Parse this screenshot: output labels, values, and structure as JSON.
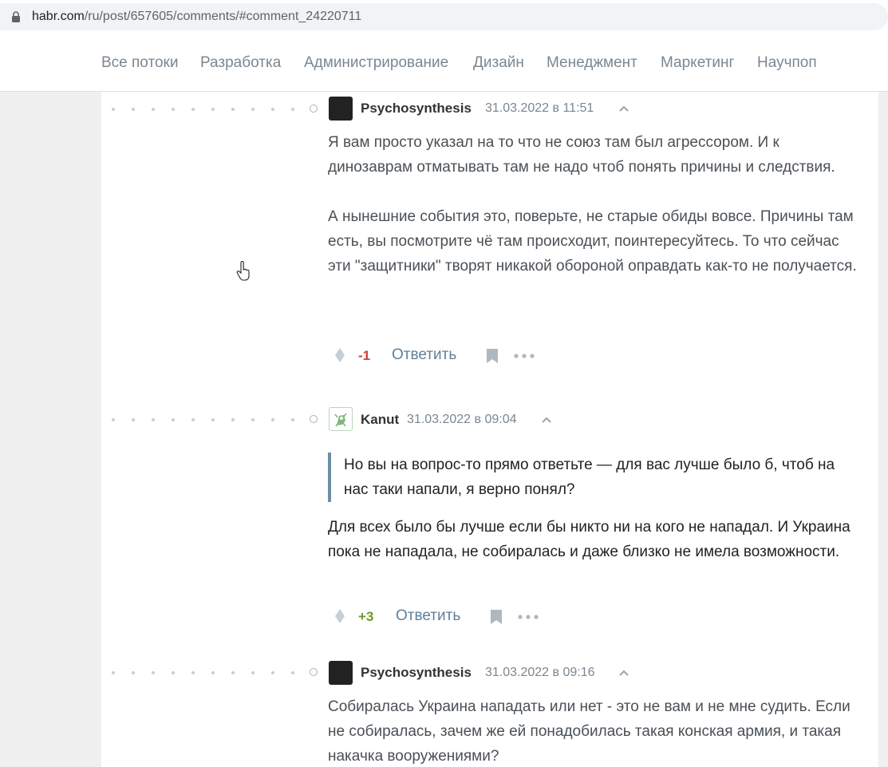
{
  "browser": {
    "url_host": "habr.com",
    "url_path": "/ru/post/657605/comments/#comment_24220711"
  },
  "nav": {
    "items": [
      "Все потоки",
      "Разработка",
      "Администрирование",
      "Дизайн",
      "Менеджмент",
      "Маркетинг",
      "Научпоп"
    ]
  },
  "comments": [
    {
      "author": "Psychosynthesis",
      "date": "31.03.2022 в 11:51",
      "paragraphs": [
        "Я вам просто указал на то что не союз там был агрессором. И к динозаврам отматывать там не надо чтоб понять причины и следствия.",
        "А нынешние события это, поверьте, не старые обиды вовсе. Причины там есть, вы посмотрите чё там происходит, поинтересуйтесь. То что сейчас эти \"защитники\" творят никакой обороной оправдать как-то не получается."
      ],
      "score": "-1",
      "reply_label": "Ответить",
      "avatar": "dark"
    },
    {
      "author": "Kanut",
      "date": "31.03.2022 в 09:04",
      "quote": "Но вы на вопрос-то прямо ответьте — для вас лучше было б, чтоб на нас таки напали, я верно понял?",
      "paragraphs": [
        "Для всех было бы лучше если бы никто ни на кого не нападал. И Украина пока не нападала, не собиралась и даже близко не имела возможности."
      ],
      "score": "+3",
      "reply_label": "Ответить",
      "avatar": "light"
    },
    {
      "author": "Psychosynthesis",
      "date": "31.03.2022 в 09:16",
      "paragraphs": [
        "Собиралась Украина нападать или нет - это не вам и не мне судить. Если не собиралась, зачем же ей понадобилась такая конская армия, и такая накачка вооружениями?"
      ],
      "avatar": "dark"
    }
  ],
  "colors": {
    "score_negative": "#d33c3c",
    "score_positive": "#6c9b25",
    "link": "#5e7f99",
    "quote_bar": "#6d8fa4"
  },
  "icons": [
    "lock-icon",
    "chevron-up-icon",
    "vote-icon",
    "bookmark-icon",
    "more-icon",
    "hand-cursor-icon",
    "kanut-avatar-icon"
  ]
}
